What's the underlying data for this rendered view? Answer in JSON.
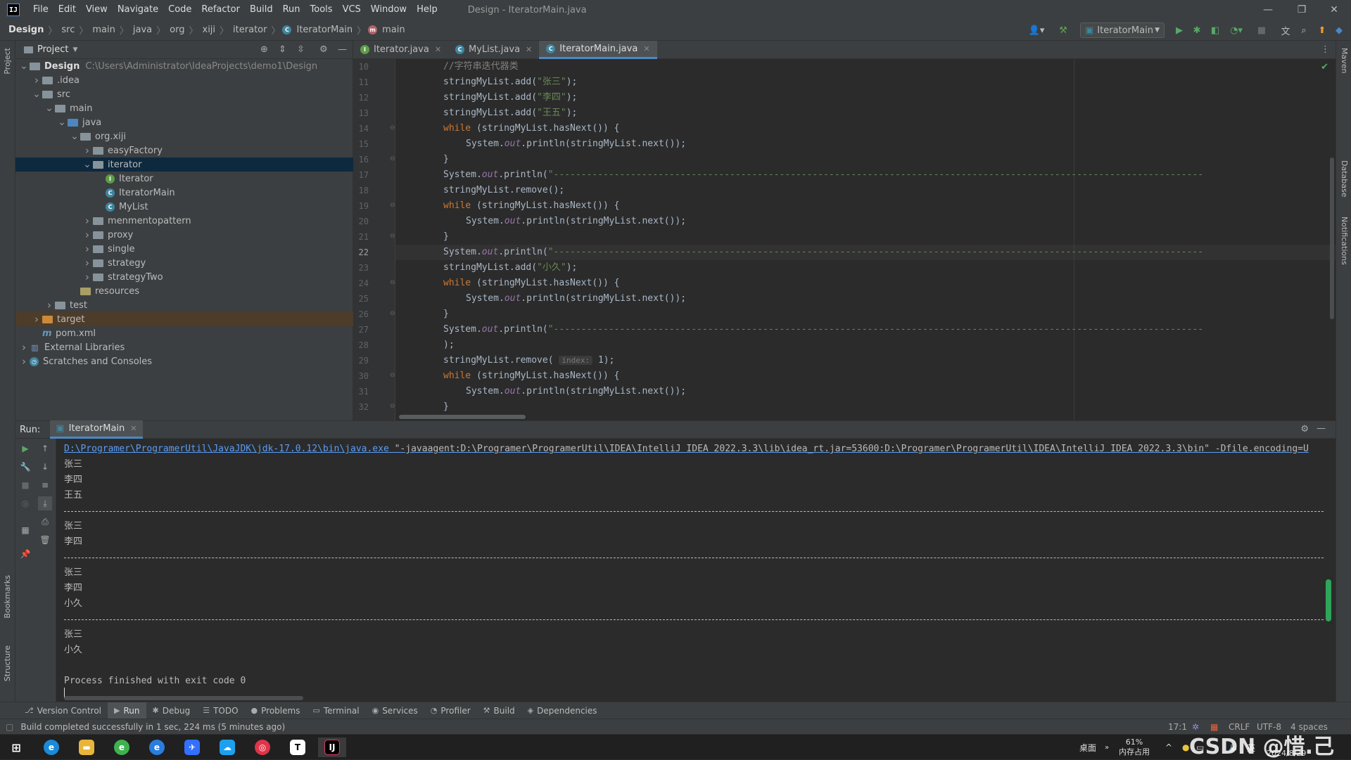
{
  "menubar": {
    "items": [
      "File",
      "Edit",
      "View",
      "Navigate",
      "Code",
      "Refactor",
      "Build",
      "Run",
      "Tools",
      "VCS",
      "Window",
      "Help"
    ],
    "window_title": "Design - IteratorMain.java"
  },
  "breadcrumb": [
    "Design",
    "src",
    "main",
    "java",
    "org",
    "xiji",
    "iterator",
    "IteratorMain",
    "main"
  ],
  "run_config": "IteratorMain",
  "project_panel": {
    "title": "Project",
    "tree": [
      {
        "label": "Design",
        "extra": "C:\\Users\\Administrator\\IdeaProjects\\demo1\\Design",
        "depth": 0,
        "arrow": "open",
        "icon": "folder",
        "bold": true
      },
      {
        "label": ".idea",
        "depth": 1,
        "arrow": "closed",
        "icon": "folder"
      },
      {
        "label": "src",
        "depth": 1,
        "arrow": "open",
        "icon": "folder"
      },
      {
        "label": "main",
        "depth": 2,
        "arrow": "open",
        "icon": "folder"
      },
      {
        "label": "java",
        "depth": 3,
        "arrow": "open",
        "icon": "folder-src"
      },
      {
        "label": "org.xiji",
        "depth": 4,
        "arrow": "open",
        "icon": "folder"
      },
      {
        "label": "easyFactory",
        "depth": 5,
        "arrow": "closed",
        "icon": "folder"
      },
      {
        "label": "iterator",
        "depth": 5,
        "arrow": "open",
        "icon": "folder",
        "selected": true
      },
      {
        "label": "Iterator",
        "depth": 6,
        "arrow": "none",
        "icon": "interface"
      },
      {
        "label": "IteratorMain",
        "depth": 6,
        "arrow": "none",
        "icon": "class"
      },
      {
        "label": "MyList",
        "depth": 6,
        "arrow": "none",
        "icon": "class"
      },
      {
        "label": "menmentopattern",
        "depth": 5,
        "arrow": "closed",
        "icon": "folder"
      },
      {
        "label": "proxy",
        "depth": 5,
        "arrow": "closed",
        "icon": "folder"
      },
      {
        "label": "single",
        "depth": 5,
        "arrow": "closed",
        "icon": "folder"
      },
      {
        "label": "strategy",
        "depth": 5,
        "arrow": "closed",
        "icon": "folder"
      },
      {
        "label": "strategyTwo",
        "depth": 5,
        "arrow": "closed",
        "icon": "folder"
      },
      {
        "label": "resources",
        "depth": 4,
        "arrow": "none",
        "icon": "folder-res"
      },
      {
        "label": "test",
        "depth": 2,
        "arrow": "closed",
        "icon": "folder"
      },
      {
        "label": "target",
        "depth": 1,
        "arrow": "closed",
        "icon": "folder-orange",
        "excluded": true
      },
      {
        "label": "pom.xml",
        "depth": 1,
        "arrow": "none",
        "icon": "maven"
      },
      {
        "label": "External Libraries",
        "depth": 0,
        "arrow": "closed",
        "icon": "library"
      },
      {
        "label": "Scratches and Consoles",
        "depth": 0,
        "arrow": "closed",
        "icon": "scratch"
      }
    ]
  },
  "editor_tabs": [
    {
      "label": "Iterator.java",
      "icon": "interface"
    },
    {
      "label": "MyList.java",
      "icon": "class"
    },
    {
      "label": "IteratorMain.java",
      "icon": "class",
      "active": true
    }
  ],
  "code": [
    {
      "n": "10",
      "parts": [
        [
          "cm",
          "//字符串迭代器类"
        ]
      ],
      "indent": 2
    },
    {
      "n": "11",
      "parts": [
        [
          "",
          "stringMyList.add("
        ],
        [
          "st",
          "\"张三\""
        ],
        [
          "",
          ");"
        ]
      ],
      "indent": 2
    },
    {
      "n": "12",
      "parts": [
        [
          "",
          "stringMyList.add("
        ],
        [
          "st",
          "\"李四\""
        ],
        [
          "",
          ");"
        ]
      ],
      "indent": 2
    },
    {
      "n": "13",
      "parts": [
        [
          "",
          "stringMyList.add("
        ],
        [
          "st",
          "\"王五\""
        ],
        [
          "",
          ");"
        ]
      ],
      "indent": 2
    },
    {
      "n": "14",
      "parts": [
        [
          "kw",
          "while "
        ],
        [
          "",
          "(stringMyList.hasNext()) {"
        ]
      ],
      "indent": 2,
      "fold": true
    },
    {
      "n": "15",
      "parts": [
        [
          "",
          "System."
        ],
        [
          "fi",
          "out"
        ],
        [
          "",
          ".println(stringMyList.next());"
        ]
      ],
      "indent": 3
    },
    {
      "n": "16",
      "parts": [
        [
          "",
          "}"
        ]
      ],
      "indent": 2,
      "fold": true
    },
    {
      "n": "17",
      "parts": [
        [
          "",
          "System."
        ],
        [
          "fi",
          "out"
        ],
        [
          "",
          ".println("
        ],
        [
          "st",
          "\"----------------------------------------------------------------------------------------------------------------------"
        ]
      ],
      "indent": 2
    },
    {
      "n": "18",
      "parts": [
        [
          "",
          "stringMyList.remove();"
        ]
      ],
      "indent": 2
    },
    {
      "n": "19",
      "parts": [
        [
          "kw",
          "while "
        ],
        [
          "",
          "(stringMyList.hasNext()) {"
        ]
      ],
      "indent": 2,
      "fold": true
    },
    {
      "n": "20",
      "parts": [
        [
          "",
          "System."
        ],
        [
          "fi",
          "out"
        ],
        [
          "",
          ".println(stringMyList.next());"
        ]
      ],
      "indent": 3
    },
    {
      "n": "21",
      "parts": [
        [
          "",
          "}"
        ]
      ],
      "indent": 2,
      "fold": true
    },
    {
      "n": "22",
      "parts": [
        [
          "",
          "System."
        ],
        [
          "fi",
          "out"
        ],
        [
          "",
          ".println("
        ],
        [
          "st",
          "\"----------------------------------------------------------------------------------------------------------------------"
        ]
      ],
      "indent": 2,
      "current": true
    },
    {
      "n": "23",
      "parts": [
        [
          "",
          "stringMyList.add("
        ],
        [
          "st",
          "\"小久\""
        ],
        [
          "",
          ");"
        ]
      ],
      "indent": 2
    },
    {
      "n": "24",
      "parts": [
        [
          "kw",
          "while "
        ],
        [
          "",
          "(stringMyList.hasNext()) {"
        ]
      ],
      "indent": 2,
      "fold": true
    },
    {
      "n": "25",
      "parts": [
        [
          "",
          "System."
        ],
        [
          "fi",
          "out"
        ],
        [
          "",
          ".println(stringMyList.next());"
        ]
      ],
      "indent": 3
    },
    {
      "n": "26",
      "parts": [
        [
          "",
          "}"
        ]
      ],
      "indent": 2,
      "fold": true
    },
    {
      "n": "27",
      "parts": [
        [
          "",
          "System."
        ],
        [
          "fi",
          "out"
        ],
        [
          "",
          ".println("
        ],
        [
          "st",
          "\"----------------------------------------------------------------------------------------------------------------------"
        ]
      ],
      "indent": 2
    },
    {
      "n": "28",
      "parts": [
        [
          "",
          ");"
        ]
      ],
      "indent": 2
    },
    {
      "n": "29",
      "parts": [
        [
          "",
          "stringMyList.remove( "
        ],
        [
          "hint",
          "index:"
        ],
        [
          "",
          " 1);"
        ]
      ],
      "indent": 2
    },
    {
      "n": "30",
      "parts": [
        [
          "kw",
          "while "
        ],
        [
          "",
          "(stringMyList.hasNext()) {"
        ]
      ],
      "indent": 2,
      "fold": true
    },
    {
      "n": "31",
      "parts": [
        [
          "",
          "System."
        ],
        [
          "fi",
          "out"
        ],
        [
          "",
          ".println(stringMyList.next());"
        ]
      ],
      "indent": 3
    },
    {
      "n": "32",
      "parts": [
        [
          "",
          "}"
        ]
      ],
      "indent": 2,
      "fold": true
    }
  ],
  "run_panel": {
    "label": "Run:",
    "tab": "IteratorMain",
    "command_path": "D:\\Programer\\ProgramerUtil\\JavaJDK\\jdk-17.0.12\\bin\\java.exe",
    "command_args": " \"-javaagent:D:\\Programer\\ProgramerUtil\\IDEA\\IntelliJ IDEA 2022.3.3\\lib\\idea_rt.jar=53600:D:\\Programer\\ProgramerUtil\\IDEA\\IntelliJ IDEA 2022.3.3\\bin\" -Dfile.encoding=U",
    "output": [
      "张三",
      "李四",
      "王五",
      "---",
      "张三",
      "李四",
      "---",
      "张三",
      "李四",
      "小久",
      "---",
      "张三",
      "小久",
      "",
      "Process finished with exit code 0"
    ]
  },
  "bottom_tools": [
    {
      "label": "Version Control",
      "icon": "⎇"
    },
    {
      "label": "Run",
      "icon": "▶",
      "active": true
    },
    {
      "label": "Debug",
      "icon": "✱"
    },
    {
      "label": "TODO",
      "icon": "☰"
    },
    {
      "label": "Problems",
      "icon": "●"
    },
    {
      "label": "Terminal",
      "icon": "▭"
    },
    {
      "label": "Services",
      "icon": "◉"
    },
    {
      "label": "Profiler",
      "icon": "◔"
    },
    {
      "label": "Build",
      "icon": "⚒"
    },
    {
      "label": "Dependencies",
      "icon": "◈"
    }
  ],
  "status": {
    "message": "Build completed successfully in 1 sec, 224 ms (5 minutes ago)",
    "position": "17:1",
    "line_sep": "CRLF",
    "encoding": "UTF-8",
    "indent": "4 spaces"
  },
  "side_labels": {
    "left_top": "Project",
    "left_bookmarks": "Bookmarks",
    "left_structure": "Structure",
    "right_maven": "Maven",
    "right_db": "Database",
    "right_notif": "Notifications"
  },
  "taskbar": {
    "desktop": "桌面",
    "mem_pct": "61%",
    "mem_label": "内存占用",
    "ime": "英",
    "date": "2024/8/29",
    "watermark": "CSDN @惜.己"
  }
}
